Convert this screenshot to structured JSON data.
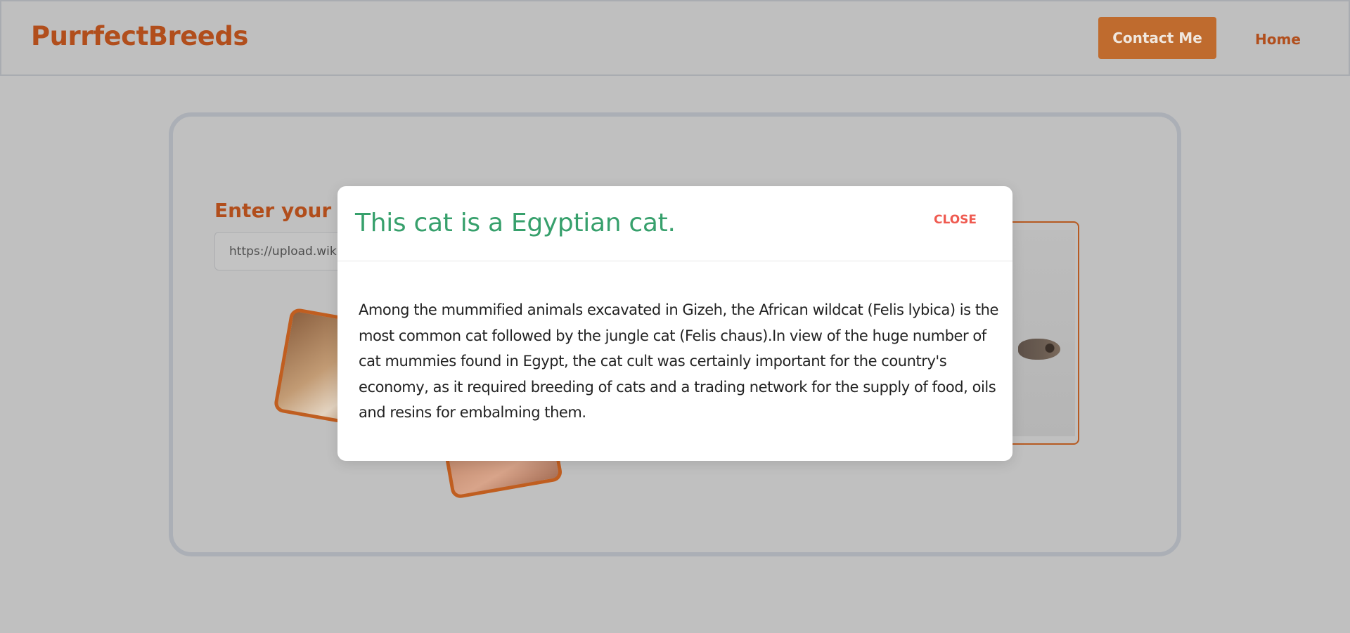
{
  "header": {
    "brand": "PurrfectBreeds",
    "contact_label": "Contact Me",
    "home_label": "Home"
  },
  "main": {
    "url_label": "Enter your URL",
    "url_value": "https://upload.wikimedia.org/wikipedia/commons/"
  },
  "modal": {
    "title": "This cat is a Egyptian cat.",
    "close_label": "CLOSE",
    "description": "Among the mummified animals excavated in Gizeh, the African wildcat (Felis lybica) is the most common cat followed by the jungle cat (Felis chaus).In view of the huge number of cat mummies found in Egypt, the cat cult was certainly important for the country's economy, as it required breeding of cats and a trading network for the supply of food, oils and resins for embalming them."
  },
  "colors": {
    "brand": "#b14e1c",
    "button": "#bf6b2e",
    "title_green": "#37a06c",
    "close_red": "#ef5a50",
    "overlay": "#c0c0c0"
  }
}
